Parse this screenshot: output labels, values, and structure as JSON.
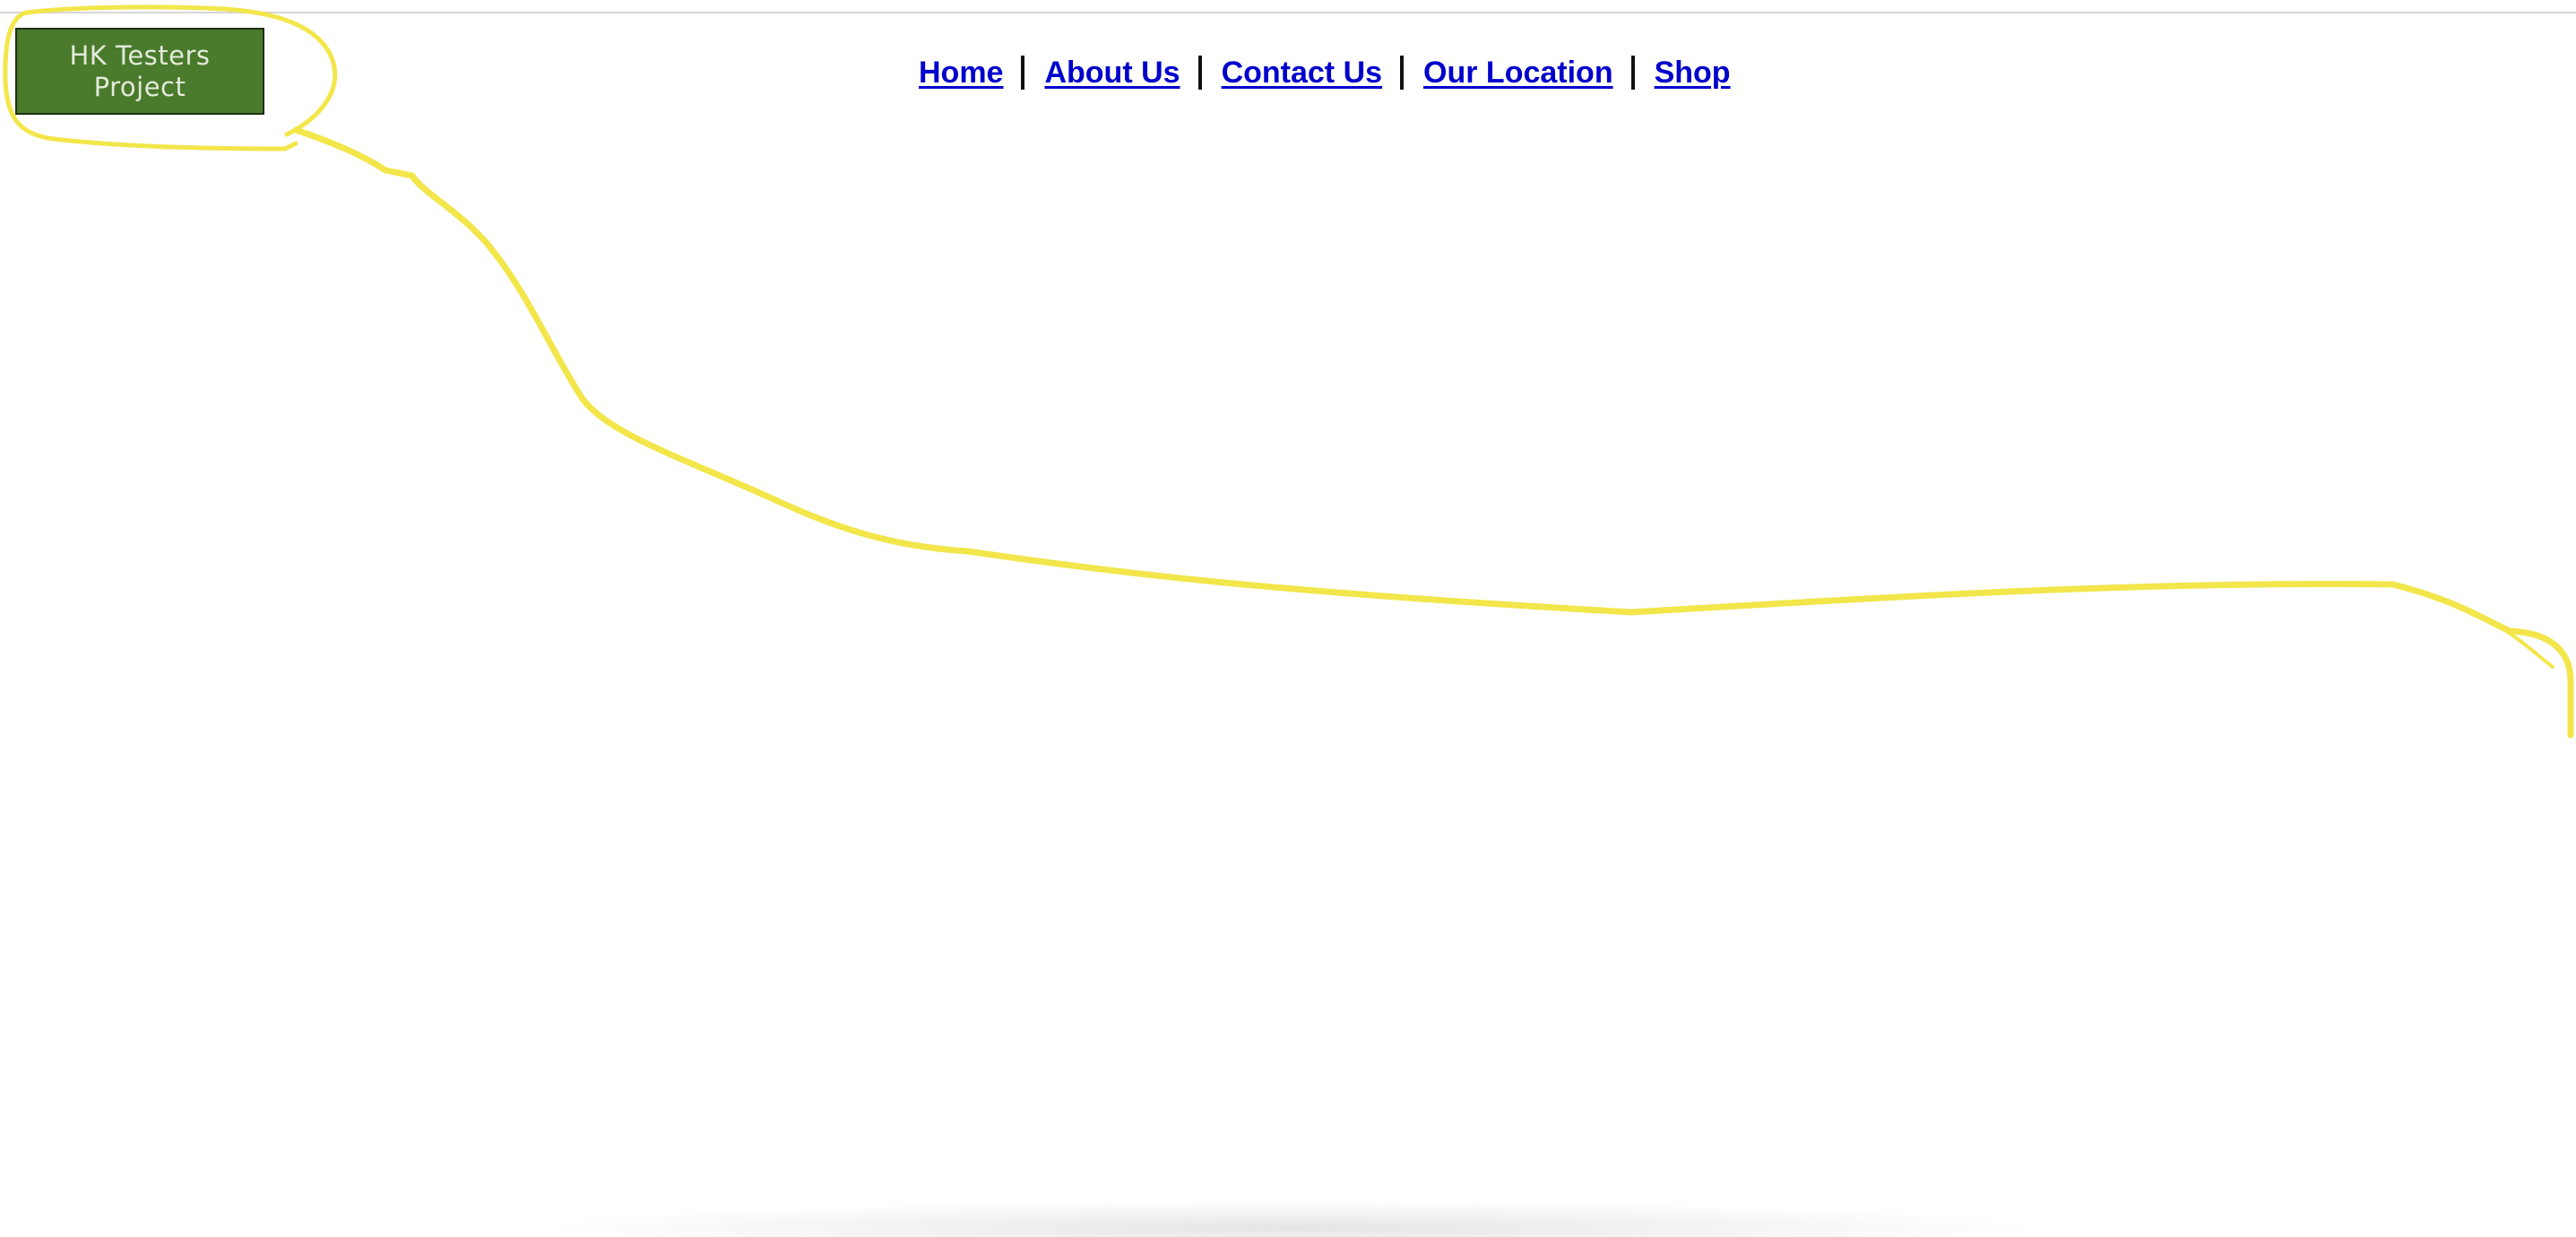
{
  "header": {
    "logo_text": "HK Testers\nProject"
  },
  "nav": {
    "items": [
      {
        "label": "Home"
      },
      {
        "label": "About Us"
      },
      {
        "label": "Contact Us"
      },
      {
        "label": "Our Location"
      },
      {
        "label": "Shop"
      }
    ]
  },
  "annotation": {
    "color": "#f2e64a"
  },
  "colors": {
    "logo_background": "#4a7a2c",
    "link": "#0000cc"
  }
}
